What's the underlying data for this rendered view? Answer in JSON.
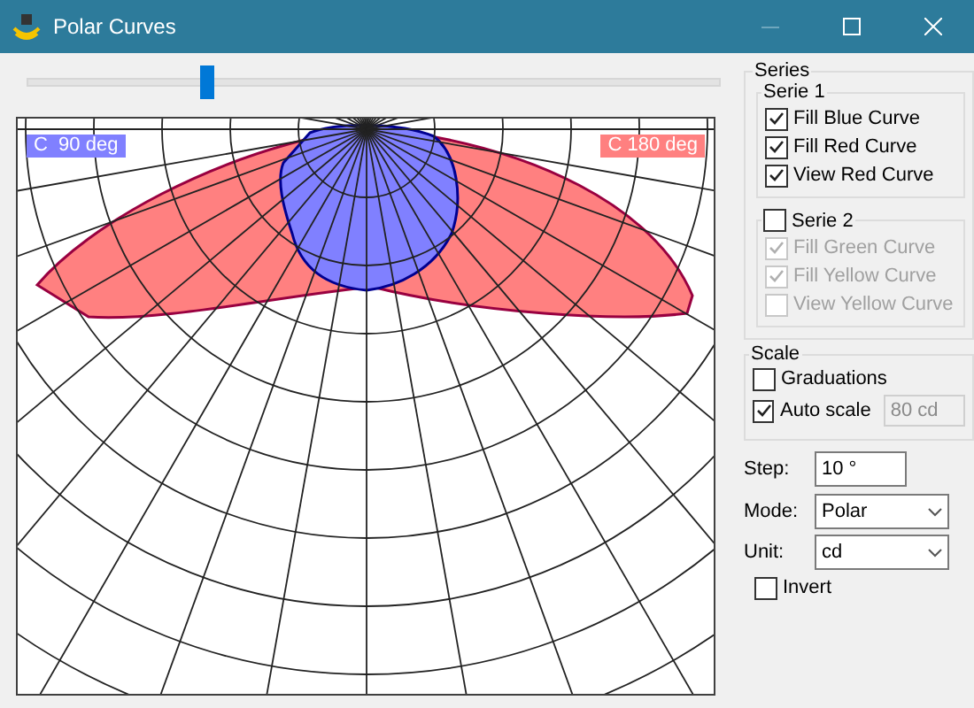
{
  "window": {
    "title": "Polar Curves"
  },
  "slider": {
    "level": 0.26
  },
  "chart": {
    "labels": [
      {
        "text": "C  90 deg",
        "color": "#8080ff"
      },
      {
        "text": "C 180 deg",
        "color": "#ff8080"
      }
    ]
  },
  "series": {
    "title": "Series",
    "groups": [
      {
        "title": "Serie 1",
        "kind": "plain",
        "items": [
          {
            "label": "Fill Blue Curve",
            "checked": true,
            "disabled": false
          },
          {
            "label": "Fill Red Curve",
            "checked": true,
            "disabled": false
          },
          {
            "label": "View Red Curve",
            "checked": true,
            "disabled": false
          }
        ]
      },
      {
        "title": "Serie 2",
        "kind": "checkbox",
        "checked": false,
        "items": [
          {
            "label": "Fill Green Curve",
            "checked": true,
            "disabled": true
          },
          {
            "label": "Fill Yellow Curve",
            "checked": true,
            "disabled": true
          },
          {
            "label": "View Yellow Curve",
            "checked": false,
            "disabled": true
          }
        ]
      }
    ]
  },
  "scale": {
    "title": "Scale",
    "graduations": {
      "label": "Graduations",
      "checked": false
    },
    "auto_scale": {
      "label": "Auto scale",
      "checked": true
    },
    "value": "80 cd"
  },
  "step": {
    "label": "Step:",
    "value": "10 °"
  },
  "mode": {
    "label": "Mode:",
    "value": "Polar"
  },
  "unit": {
    "label": "Unit:",
    "value": "cd"
  },
  "invert": {
    "label": "Invert",
    "checked": false
  }
}
